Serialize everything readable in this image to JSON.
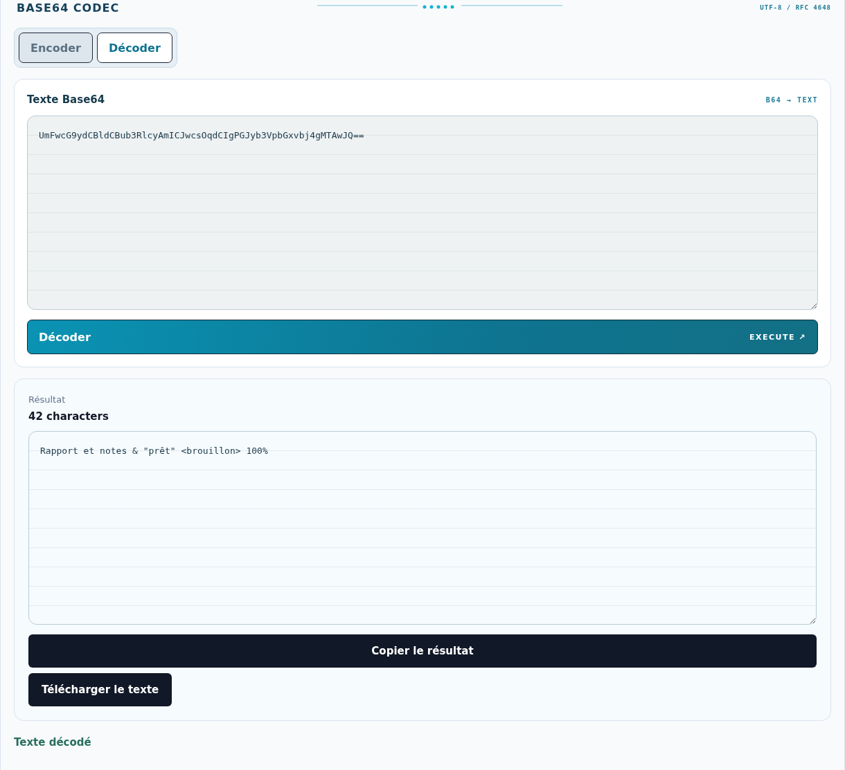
{
  "header": {
    "title": "BASE64 CODEC",
    "tag": "UTF-8 / RFC 4648"
  },
  "tabs": [
    {
      "label": "Encoder",
      "selected": false
    },
    {
      "label": "Décoder",
      "selected": true
    }
  ],
  "input_card": {
    "title": "Texte Base64",
    "badge": "B64 → TEXT",
    "value": "UmFwcG9ydCBldCBub3RlcyAmICJwcsOqdCIgPGJyb3VpbGxvbj4gMTAwJQ==",
    "action": {
      "label": "Décoder",
      "hint": "EXECUTE ↗"
    }
  },
  "result_card": {
    "label": "Résultat",
    "count": "42 characters",
    "value": "Rapport et notes & \"prêt\" <brouillon> 100%",
    "buttons": [
      "Copier le résultat",
      "Télécharger le texte"
    ]
  },
  "footer": {
    "caption": "Texte décodé"
  }
}
